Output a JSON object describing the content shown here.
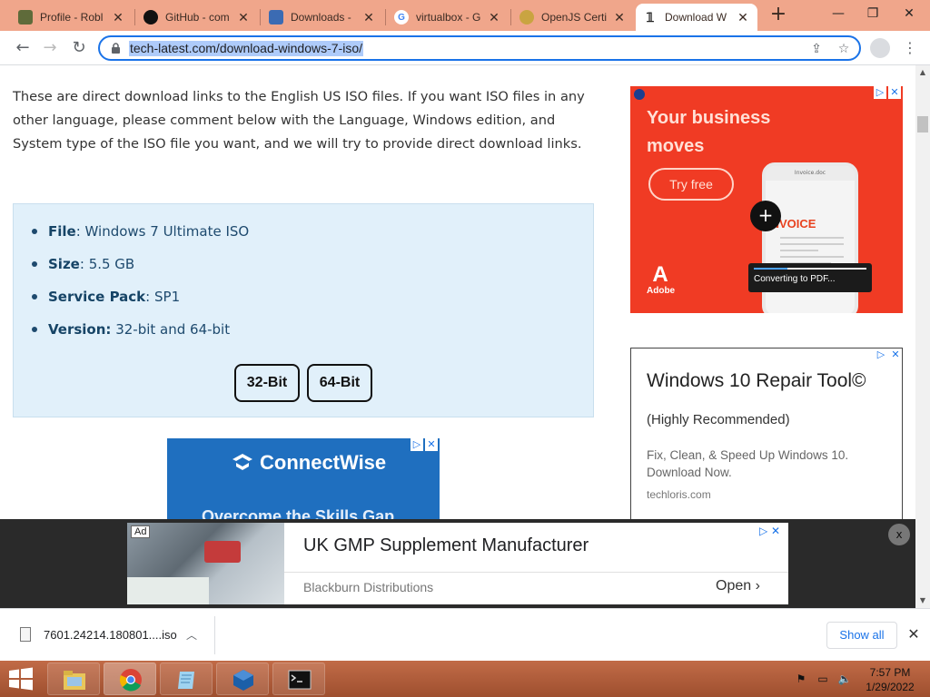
{
  "tabs": [
    {
      "title": "Profile - Robl",
      "icon": "book-icon",
      "color": "#5f6b3a"
    },
    {
      "title": "GitHub - com",
      "icon": "github-icon",
      "color": "#111111"
    },
    {
      "title": "Downloads -",
      "icon": "downloads-icon",
      "color": "#3b6bb3"
    },
    {
      "title": "virtualbox - G",
      "icon": "google-icon",
      "color": "#4285f4"
    },
    {
      "title": "OpenJS Certi",
      "icon": "openjs-icon",
      "color": "#c9a441"
    },
    {
      "title": "Download W",
      "icon": "tech-latest-icon",
      "color": "#222222",
      "active": true
    }
  ],
  "browser": {
    "url": "tech-latest.com/download-windows-7-iso/"
  },
  "article": {
    "intro": "These are direct download links to the English US ISO files. If you want ISO files in any other language, please comment below with the Language, Windows edition, and System type of the ISO file you want, and we will try to provide direct download links.",
    "info": [
      {
        "label": "File",
        "sep": ": ",
        "value": "Windows 7 Ultimate ISO"
      },
      {
        "label": "Size",
        "sep": ": ",
        "value": "5.5 GB"
      },
      {
        "label": "Service Pack",
        "sep": ": ",
        "value": "SP1"
      },
      {
        "label": "Version:",
        "sep": " ",
        "value": "32-bit and 64-bit"
      }
    ],
    "buttons": {
      "b32": "32-Bit",
      "b64": "64-Bit"
    }
  },
  "ads": {
    "connectwise": {
      "brand": "ConnectWise",
      "headline": "Overcome the Skills Gap"
    },
    "adobe": {
      "headline": "Your business moves",
      "cta": "Try free",
      "phone_header": "Invoice.doc",
      "invoice": "INVOICE",
      "converting": "Converting to PDF...",
      "progress": 0.3,
      "logo": "Adobe"
    },
    "repair": {
      "title": "Windows 10 Repair Tool©",
      "subtitle": "(Highly Recommended)",
      "desc": "Fix, Clean, & Speed Up Windows 10. Download Now.",
      "url": "techloris.com"
    },
    "anchor": {
      "tag": "Ad",
      "title": "UK GMP Supplement Manufacturer",
      "brand": "Blackburn Distributions",
      "open": "Open",
      "close": "x"
    }
  },
  "download_shelf": {
    "file": "7601.24214.180801....iso",
    "show_all": "Show all"
  },
  "taskbar": {
    "apps": [
      "file-explorer-icon",
      "chrome-icon",
      "notepad-icon",
      "virtualbox-icon",
      "cmd-icon"
    ],
    "time": "7:57 PM",
    "date": "1/29/2022"
  }
}
